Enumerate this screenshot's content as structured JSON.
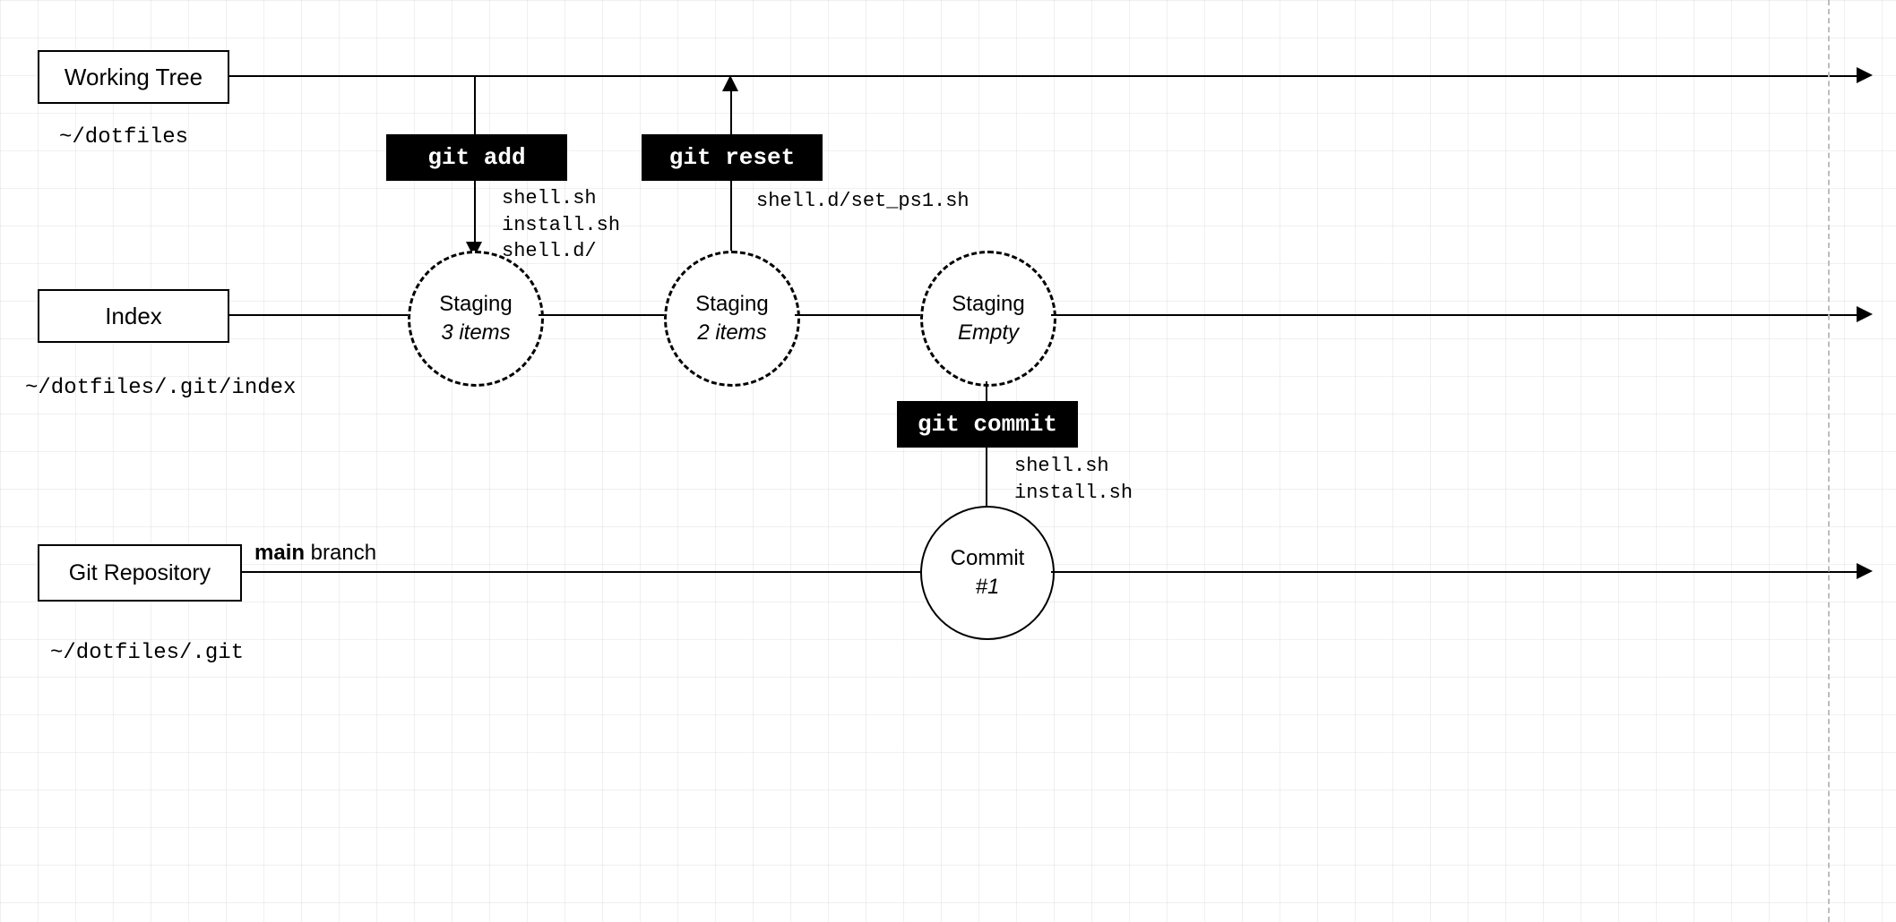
{
  "lanes": {
    "working_tree": {
      "title": "Working Tree",
      "path": "~/dotfiles"
    },
    "index": {
      "title": "Index",
      "path": "~/dotfiles/.git/index"
    },
    "repo": {
      "title": "Git Repository",
      "path": "~/dotfiles/.git"
    }
  },
  "commands": {
    "git_add": {
      "label": "git add",
      "files": "shell.sh\ninstall.sh\nshell.d/"
    },
    "git_reset": {
      "label": "git reset",
      "files": "shell.d/set_ps1.sh"
    },
    "git_commit": {
      "label": "git commit",
      "files": "shell.sh\ninstall.sh"
    }
  },
  "staging": {
    "s1": {
      "title": "Staging",
      "detail": "3 items"
    },
    "s2": {
      "title": "Staging",
      "detail": "2 items"
    },
    "s3": {
      "title": "Staging",
      "detail": "Empty"
    }
  },
  "commit_node": {
    "title": "Commit",
    "detail": "#1"
  },
  "branch": {
    "name_bold": "main",
    "name_rest": " branch"
  }
}
